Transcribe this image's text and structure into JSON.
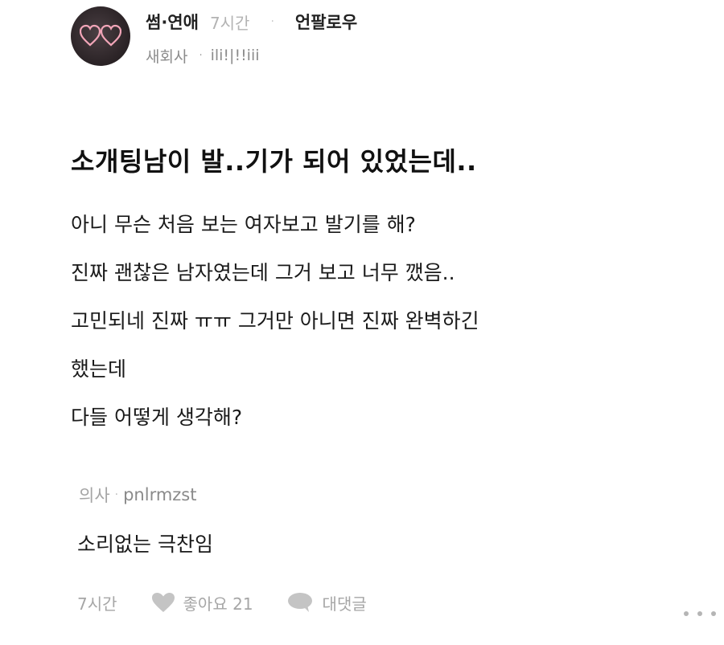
{
  "post": {
    "category": "썸·연애",
    "time": "7시간",
    "separator": "·",
    "unfollow_label": "언팔로우",
    "author_job": "새회사",
    "author_separator": "·",
    "author_name": "ili!|!!iii",
    "avatar_icon": "pink-hearts-neon-icon",
    "title": "소개팅남이 발..기가 되어 있었는데..",
    "body_lines": [
      "아니 무슨 처음 보는 여자보고 발기를 해?",
      "진짜 괜찮은 남자였는데 그거 보고 너무 깼음..",
      "고민되네 진짜 ㅠㅠ 그거만 아니면 진짜 완벽하긴",
      "했는데",
      "다들 어떻게 생각해?"
    ]
  },
  "comment": {
    "job": "의사",
    "separator": "·",
    "username": "pnlrmzst",
    "text": "소리없는 극찬임",
    "time": "7시간",
    "like_label": "좋아요 21",
    "like_icon": "heart-icon",
    "reply_label": "대댓글",
    "reply_icon": "speech-bubble-icon",
    "more_icon": "more-dots-icon"
  },
  "colors": {
    "avatar_bg": "#2e2629",
    "heart_neon": "#f2a5b8",
    "muted_text": "#a6a6a6",
    "icon_gray": "#c4c4c4"
  }
}
